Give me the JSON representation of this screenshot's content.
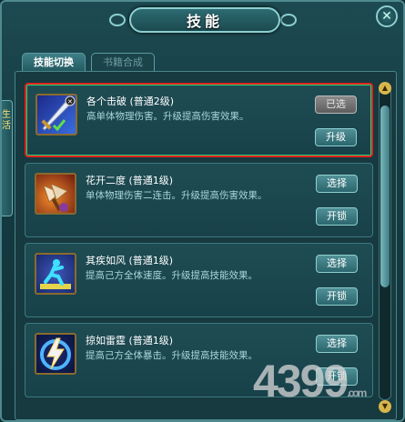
{
  "window": {
    "title": "技能"
  },
  "side_tab": {
    "label": "生活"
  },
  "tabs": [
    {
      "label": "技能切换",
      "active": true
    },
    {
      "label": "书籍合成",
      "active": false
    }
  ],
  "skills": [
    {
      "name": "各个击破 (普通2级)",
      "desc": "高单体物理伤害。升级提高伤害效果。",
      "primary": "已选",
      "secondary": "升级",
      "icon": "sword-icon"
    },
    {
      "name": "花开二度 (普通1级)",
      "desc": "单体物理伤害二连击。升级提高伤害效果。",
      "primary": "选择",
      "secondary": "开锁",
      "icon": "double-axe-icon"
    },
    {
      "name": "其疾如风 (普通1级)",
      "desc": "提高己方全体速度。升级提高技能效果。",
      "primary": "选择",
      "secondary": "开锁",
      "icon": "running-man-icon"
    },
    {
      "name": "掠如雷霆 (普通1级)",
      "desc": "提高己方全体暴击。升级提高技能效果。",
      "primary": "选择",
      "secondary": "开锁",
      "icon": "lightning-icon"
    }
  ],
  "watermark": {
    "text": "4399",
    "suffix": ".com"
  },
  "colors": {
    "selected_border": "#e2231a",
    "selected_glow": "#2bd37a",
    "panel_bg": "#163a40"
  }
}
